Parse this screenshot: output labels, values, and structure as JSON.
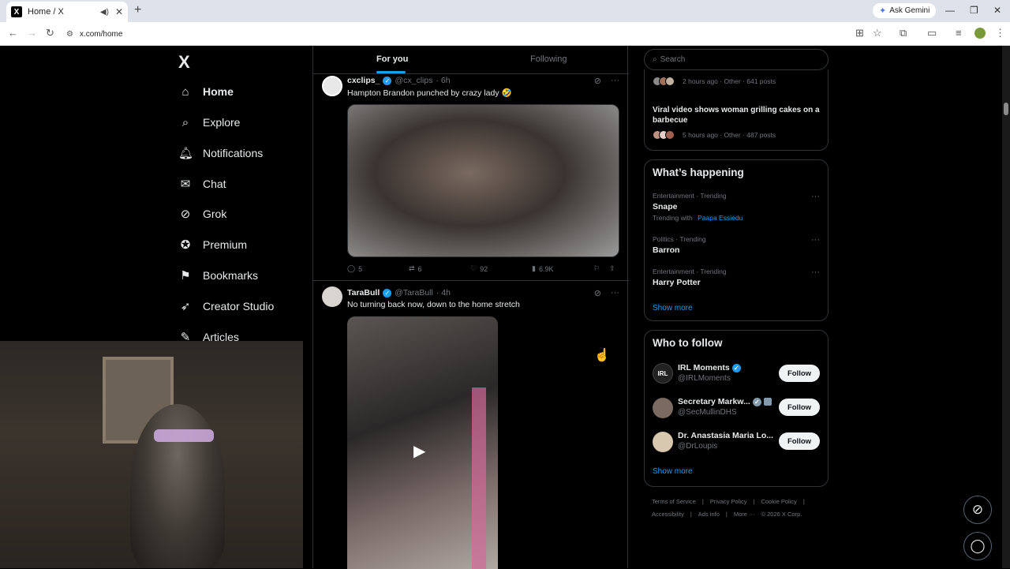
{
  "browser": {
    "tab_title": "Home / X",
    "favicon_text": "X",
    "new_tab": "+",
    "gemini_label": "Ask Gemini",
    "url": "x.com/home"
  },
  "x": {
    "logo": "X",
    "nav": [
      {
        "label": "Home",
        "icon": "home-icon",
        "glyph": "⌂"
      },
      {
        "label": "Explore",
        "icon": "search-icon",
        "glyph": "⌕"
      },
      {
        "label": "Notifications",
        "icon": "bell-icon",
        "glyph": "🔔"
      },
      {
        "label": "Chat",
        "icon": "mail-icon",
        "glyph": "✉"
      },
      {
        "label": "Grok",
        "icon": "grok-icon",
        "glyph": "⊘"
      },
      {
        "label": "Premium",
        "icon": "premium-icon",
        "glyph": "✪"
      },
      {
        "label": "Bookmarks",
        "icon": "bookmark-icon",
        "glyph": "⚑"
      },
      {
        "label": "Creator Studio",
        "icon": "rocket-icon",
        "glyph": "➶"
      },
      {
        "label": "Articles",
        "icon": "articles-icon",
        "glyph": "✎"
      }
    ],
    "tabs": {
      "for_you": "For you",
      "following": "Following"
    },
    "posts": [
      {
        "name": "cxclips_",
        "handle": "@cx_clips",
        "time": "· 6h",
        "text": "Hampton Brandon punched by crazy lady 🤣",
        "replies": "5",
        "reposts": "6",
        "likes": "92",
        "views": "6.9K"
      },
      {
        "name": "TaraBull",
        "handle": "@TaraBull",
        "time": "· 4h",
        "text": "No turning back now, down to the home stretch"
      }
    ],
    "search_placeholder": "Search",
    "trending_top": [
      {
        "meta": "2 hours ago · Other · 641 posts"
      },
      {
        "title": "Viral video shows woman grilling cakes on a barbecue",
        "meta": "5 hours ago · Other · 487 posts"
      }
    ],
    "whats_happening": {
      "heading": "What’s happening",
      "items": [
        {
          "category": "Entertainment · Trending",
          "name": "Snape",
          "extra_prefix": "Trending with",
          "extra_link": "Paapa Essiedu"
        },
        {
          "category": "Politics · Trending",
          "name": "Barron"
        },
        {
          "category": "Entertainment · Trending",
          "name": "Harry Potter"
        }
      ],
      "show_more": "Show more"
    },
    "who_to_follow": {
      "heading": "Who to follow",
      "items": [
        {
          "name": "IRL Moments",
          "handle": "@IRLMoments",
          "button": "Follow"
        },
        {
          "name": "Secretary Markw...",
          "handle": "@SecMullinDHS",
          "button": "Follow"
        },
        {
          "name": "Dr. Anastasia Maria Lo...",
          "handle": "@DrLoupis",
          "button": "Follow"
        }
      ],
      "show_more": "Show more"
    },
    "footer": [
      "Terms of Service",
      "|",
      "Privacy Policy",
      "|",
      "Cookie Policy",
      "|",
      "Accessibility",
      "|",
      "Ads info",
      "|",
      "More ···",
      "© 2026 X Corp."
    ]
  },
  "colors": {
    "accent": "#1d9bf0",
    "background": "#000000",
    "border": "#2f3336"
  }
}
